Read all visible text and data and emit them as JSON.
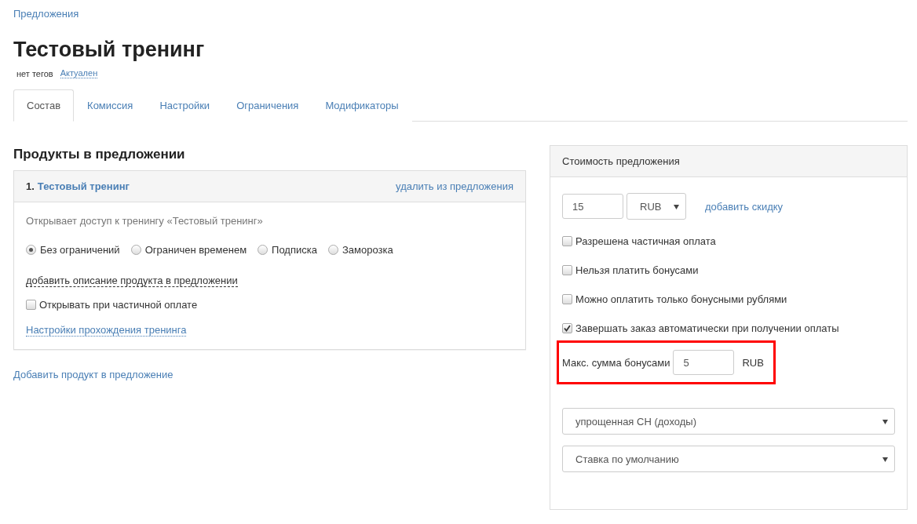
{
  "breadcrumb": "Предложения",
  "title": "Тестовый тренинг",
  "tags": {
    "label": "нет тегов",
    "status": "Актуален"
  },
  "tabs": [
    {
      "label": "Состав",
      "selected": true
    },
    {
      "label": "Комиссия",
      "selected": false
    },
    {
      "label": "Настройки",
      "selected": false
    },
    {
      "label": "Ограничения",
      "selected": false
    },
    {
      "label": "Модификаторы",
      "selected": false
    }
  ],
  "products": {
    "heading": "Продукты в предложении",
    "items": [
      {
        "number": "1.",
        "name": "Тестовый тренинг",
        "remove_link": "удалить из предложения",
        "description": "Открывает доступ к тренингу «Тестовый тренинг»",
        "access_options": [
          {
            "label": "Без ограничений",
            "selected": true
          },
          {
            "label": "Ограничен временем",
            "selected": false
          },
          {
            "label": "Подписка",
            "selected": false
          },
          {
            "label": "Заморозка",
            "selected": false
          }
        ],
        "add_description_link": "добавить описание продукта в предложении",
        "partial_payment": {
          "label": "Открывать при частичной оплате",
          "checked": false
        },
        "settings_link": "Настройки прохождения тренинга"
      }
    ],
    "add_link": "Добавить продукт в предложение"
  },
  "pricing": {
    "heading": "Стоимость предложения",
    "price": "15",
    "currency": "RUB",
    "discount_link": "добавить скидку",
    "options": [
      {
        "label": "Разрешена частичная оплата",
        "checked": false
      },
      {
        "label": "Нельзя платить бонусами",
        "checked": false
      },
      {
        "label": "Можно оплатить только бонусными рублями",
        "checked": false
      },
      {
        "label": "Завершать заказ автоматически при получении оплаты",
        "checked": true
      }
    ],
    "max_bonus": {
      "label": "Макс. сумма бонусами",
      "value": "5",
      "currency": "RUB",
      "highlighted": true
    },
    "tax_system": "упрощенная СН (доходы)",
    "tax_rate": "Ставка по умолчанию"
  }
}
